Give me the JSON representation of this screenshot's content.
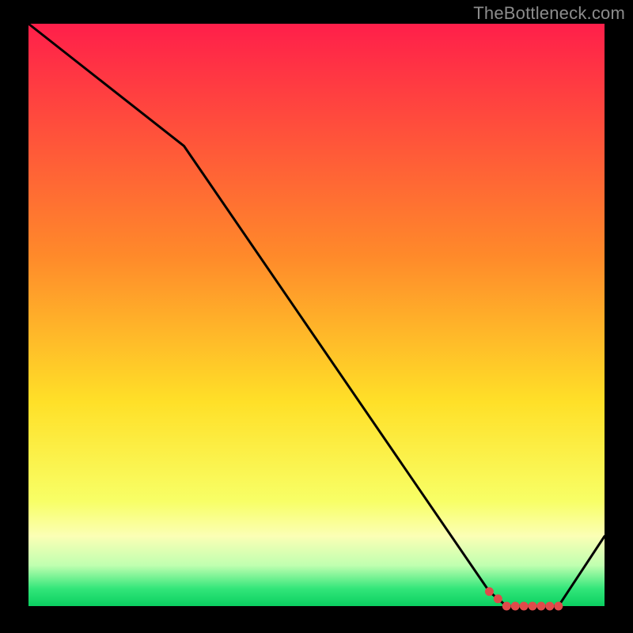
{
  "watermark": "TheBottleneck.com",
  "chart_data": {
    "type": "line",
    "title": "",
    "xlabel": "",
    "ylabel": "",
    "xlim": [
      0,
      100
    ],
    "ylim": [
      0,
      100
    ],
    "x": [
      0,
      27,
      80,
      83,
      92,
      100
    ],
    "values": [
      100,
      79,
      2.5,
      0,
      0,
      12
    ],
    "marker_range_x": [
      80,
      92
    ],
    "gradient": {
      "stops": [
        {
          "offset": 0.0,
          "color": "#ff1f4a"
        },
        {
          "offset": 0.4,
          "color": "#ff8a2a"
        },
        {
          "offset": 0.65,
          "color": "#ffe028"
        },
        {
          "offset": 0.82,
          "color": "#f8ff66"
        },
        {
          "offset": 0.88,
          "color": "#fbffb5"
        },
        {
          "offset": 0.93,
          "color": "#c0ffb0"
        },
        {
          "offset": 0.97,
          "color": "#33e67a"
        },
        {
          "offset": 1.0,
          "color": "#0acf60"
        }
      ]
    }
  }
}
